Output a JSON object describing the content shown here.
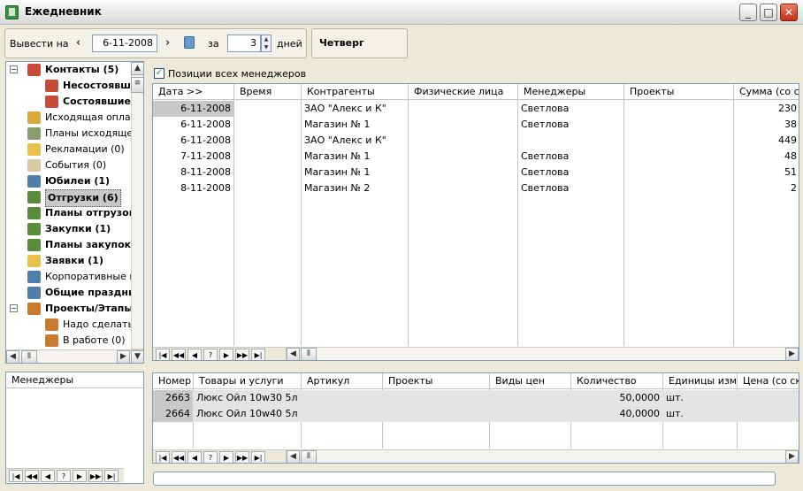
{
  "window": {
    "title": "Ежедневник",
    "min": "_",
    "max": "□",
    "close": "✕"
  },
  "toolbar": {
    "show_on_label": "Вывести на",
    "prev": "‹",
    "date_value": "6-11-2008",
    "next": "›",
    "for_label": "за",
    "days_value": "3",
    "days_label": "дней",
    "weekday": "Четверг"
  },
  "tree": {
    "items": [
      {
        "label": "Контакты (5)",
        "bold": true,
        "indent": 0,
        "expander": "−",
        "color": "#c84b3a"
      },
      {
        "label": "Несостоявш",
        "bold": true,
        "indent": 1,
        "color": "#c84b3a"
      },
      {
        "label": "Состоявшие",
        "bold": true,
        "indent": 1,
        "color": "#c84b3a"
      },
      {
        "label": "Исходящая оплата",
        "bold": false,
        "indent": 0,
        "color": "#d9a93d"
      },
      {
        "label": "Планы исходящей",
        "bold": false,
        "indent": 0,
        "color": "#8a9c6b"
      },
      {
        "label": "Рекламации (0)",
        "bold": false,
        "indent": 0,
        "color": "#e8c04a"
      },
      {
        "label": "События (0)",
        "bold": false,
        "indent": 0,
        "color": "#d9c8a0"
      },
      {
        "label": "Юбилеи (1)",
        "bold": true,
        "indent": 0,
        "color": "#4f7fa8"
      },
      {
        "label": "Отгрузки (6)",
        "bold": true,
        "indent": 0,
        "selected": true,
        "color": "#5a8a3a"
      },
      {
        "label": "Планы отгрузок",
        "bold": true,
        "indent": 0,
        "color": "#5a8a3a"
      },
      {
        "label": "Закупки (1)",
        "bold": true,
        "indent": 0,
        "color": "#5a8a3a"
      },
      {
        "label": "Планы закупок",
        "bold": true,
        "indent": 0,
        "color": "#5a8a3a"
      },
      {
        "label": "Заявки (1)",
        "bold": true,
        "indent": 0,
        "color": "#e8c04a"
      },
      {
        "label": "Корпоративные пр",
        "bold": false,
        "indent": 0,
        "color": "#4f7fa8"
      },
      {
        "label": "Общие праздни",
        "bold": true,
        "indent": 0,
        "color": "#4f7fa8"
      },
      {
        "label": "Проекты/Этапы",
        "bold": true,
        "indent": 0,
        "expander": "−",
        "color": "#c97a30"
      },
      {
        "label": "Надо сделать",
        "bold": false,
        "indent": 1,
        "color": "#c97a30"
      },
      {
        "label": "В работе (0)",
        "bold": false,
        "indent": 1,
        "color": "#c97a30"
      }
    ]
  },
  "managers_panel": {
    "title": "Менеджеры"
  },
  "checkbox": {
    "label": "Позиции всех менеджеров",
    "checked": true
  },
  "main_grid": {
    "columns": [
      "Дата >>",
      "Время",
      "Контрагенты",
      "Физические лица",
      "Менеджеры",
      "Проекты",
      "Сумма (со ски"
    ],
    "rows": [
      [
        "6-11-2008",
        "",
        "ЗАО \"Алекс и К\"",
        "",
        "Светлова",
        "",
        "230"
      ],
      [
        "6-11-2008",
        "",
        "Магазин № 1",
        "",
        "Светлова",
        "",
        "38"
      ],
      [
        "6-11-2008",
        "",
        "ЗАО \"Алекс и К\"",
        "",
        "",
        "",
        "449"
      ],
      [
        "7-11-2008",
        "",
        "Магазин № 1",
        "",
        "Светлова",
        "",
        "48"
      ],
      [
        "8-11-2008",
        "",
        "Магазин № 1",
        "",
        "Светлова",
        "",
        "51"
      ],
      [
        "8-11-2008",
        "",
        "Магазин № 2",
        "",
        "Светлова",
        "",
        "2"
      ]
    ]
  },
  "detail_grid": {
    "columns": [
      "Номер",
      "Товары и услуги",
      "Артикул",
      "Проекты",
      "Виды цен",
      "Количество",
      "Единицы измере",
      "Цена (со ски"
    ],
    "rows": [
      [
        "2663",
        "Люкс Ойл 10w30 5л",
        "",
        "",
        "",
        "50,0000",
        "шт.",
        ""
      ],
      [
        "2664",
        "Люкс Ойл 10w40 5л",
        "",
        "",
        "",
        "40,0000",
        "шт.",
        ""
      ]
    ]
  },
  "navigator": {
    "buttons": [
      "|◀",
      "◀◀",
      "◀",
      "?",
      "▶",
      "▶▶",
      "▶|"
    ]
  }
}
